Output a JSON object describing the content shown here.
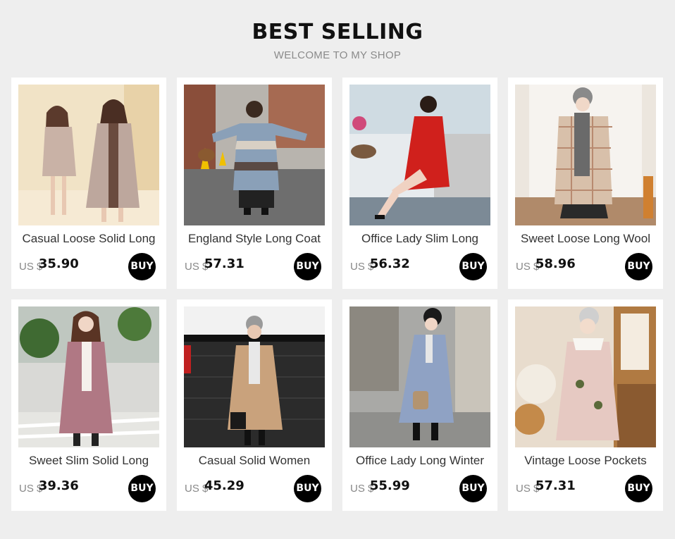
{
  "header": {
    "title": "BEST SELLING",
    "subtitle": "WELCOME TO MY SHOP"
  },
  "currency_label": "US $",
  "buy_label": "BUY",
  "products": [
    {
      "name": "Casual Loose Solid Long",
      "price": "35.90"
    },
    {
      "name": "England Style Long Coat",
      "price": "57.31"
    },
    {
      "name": "Office Lady Slim Long",
      "price": "56.32"
    },
    {
      "name": "Sweet Loose Long Wool",
      "price": "58.96"
    },
    {
      "name": "Sweet Slim Solid Long",
      "price": "39.36"
    },
    {
      "name": "Casual Solid Women",
      "price": "45.29"
    },
    {
      "name": "Office Lady Long Winter",
      "price": "55.99"
    },
    {
      "name": "Vintage Loose Pockets",
      "price": "57.31"
    }
  ],
  "colors": {
    "background": "#eeeeee",
    "card": "#ffffff",
    "buy_button": "#000000"
  }
}
